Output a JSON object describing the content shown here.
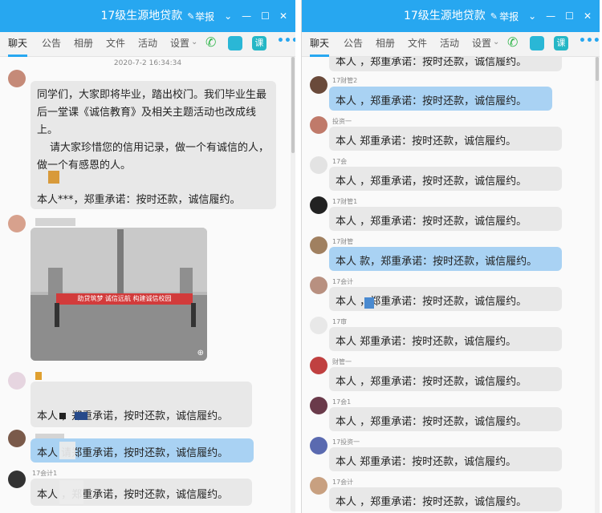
{
  "group_title": "17级生源地贷款",
  "report_label": "举报",
  "tabs": [
    "聊天",
    "公告",
    "相册",
    "文件",
    "活动",
    "设置"
  ],
  "left": {
    "timestamp": "2020-7-2 16:34:34",
    "notice": {
      "line1": "同学们，大家即将毕业，踏出校门。我们毕业生最",
      "line2": "后一堂课《诚信教育》及相关主题活动也改成线",
      "line3": "上。",
      "line4": "请大家珍惜您的信用记录，做一个有诚信的人，",
      "line5": "做一个有感恩的人。",
      "line6": "本人***，郑重承诺：按时还款，诚信履约。"
    },
    "photo_banner": "助贷筑梦  诚信远航  构建诚信校园",
    "messages": [
      {
        "sender": "",
        "text": "本人     ，郑重承诺，按时还款，诚信履约。"
      },
      {
        "sender": "",
        "text": "本人     请郑重承诺，按时还款，诚信履约。"
      },
      {
        "sender": "17会计1",
        "text": "本人       ，郑重承诺，按时还款，诚信履约。"
      }
    ]
  },
  "right": {
    "messages": [
      {
        "sender": "",
        "text": "本人      ，郑重承诺：按时还款，诚信履约。"
      },
      {
        "sender": "17财管2",
        "text": "本人      ，郑重承诺：按时还款，诚信履约。"
      },
      {
        "sender": "投资一",
        "text": "本人        郑重承诺：按时还款，诚信履约。"
      },
      {
        "sender": "17会",
        "text": "本人        ，郑重承诺，按时还款，诚信履约。"
      },
      {
        "sender": "17财管1",
        "text": "本人        ，郑重承诺：按时还款，诚信履约。"
      },
      {
        "sender": "17财管",
        "text": "本人      款，郑重承诺：按时还款，诚信履约。"
      },
      {
        "sender": "17会计",
        "text": "本人        ，郑重承诺：按时还款，诚信履约。"
      },
      {
        "sender": "17审",
        "text": "本人          郑重承诺：按时还款，诚信履约。"
      },
      {
        "sender": "财管一",
        "text": "本人        ，郑重承诺：按时还款，诚信履约。"
      },
      {
        "sender": "17会1",
        "text": "本人          ，郑重承诺：按时还款，诚信履约。"
      },
      {
        "sender": "17投资一",
        "text": "本人          郑重承诺：按时还款，诚信履约。"
      },
      {
        "sender": "17会计",
        "text": "本人        ，郑重承诺：按时还款，诚信履约。"
      }
    ]
  },
  "colors": {
    "titlebar": "#27a7f0",
    "bubble_gray": "#e8e8e8",
    "bubble_blue": "#a9d2f3"
  },
  "icons": [
    "edit-pencil-icon",
    "dropdown-arrow-icon",
    "minimize-icon",
    "maximize-icon",
    "close-icon",
    "phone-icon",
    "video-icon",
    "course-icon",
    "more-icon",
    "zoom-icon"
  ]
}
